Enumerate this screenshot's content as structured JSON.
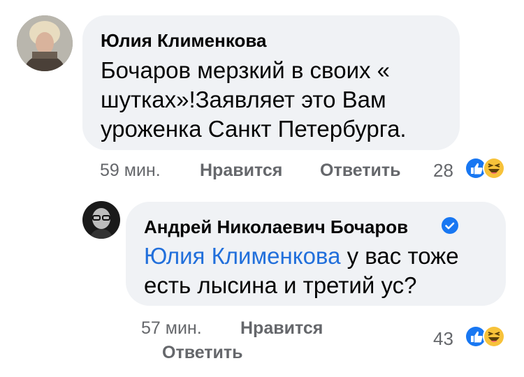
{
  "comments": [
    {
      "author": "Юлия Клименкова",
      "text": "Бочаров мерзкий в своих « шутках»!Заявляет это Вам уроженка Санкт Петербурга.",
      "time": "59 мин.",
      "like_label": "Нравится",
      "reply_label": "Ответить",
      "reaction_count": "28",
      "reactions": [
        "like-icon",
        "haha-icon"
      ]
    }
  ],
  "reply": {
    "author": "Андрей Николаевич Бочаров",
    "verified": true,
    "mention": "Юлия Клименкова",
    "text_after_mention": " у вас тоже есть лысина и третий ус?",
    "time": "57 мин.",
    "like_label": "Нравится",
    "reply_label": "Ответить",
    "reaction_count": "43",
    "reactions": [
      "like-icon",
      "haha-icon"
    ]
  },
  "colors": {
    "bubble": "#f0f2f5",
    "meta_text": "#65676b",
    "mention": "#216fdb",
    "like_blue": "#1877f2",
    "haha_yellow": "#f7c23a",
    "verified_blue": "#1877f2"
  }
}
